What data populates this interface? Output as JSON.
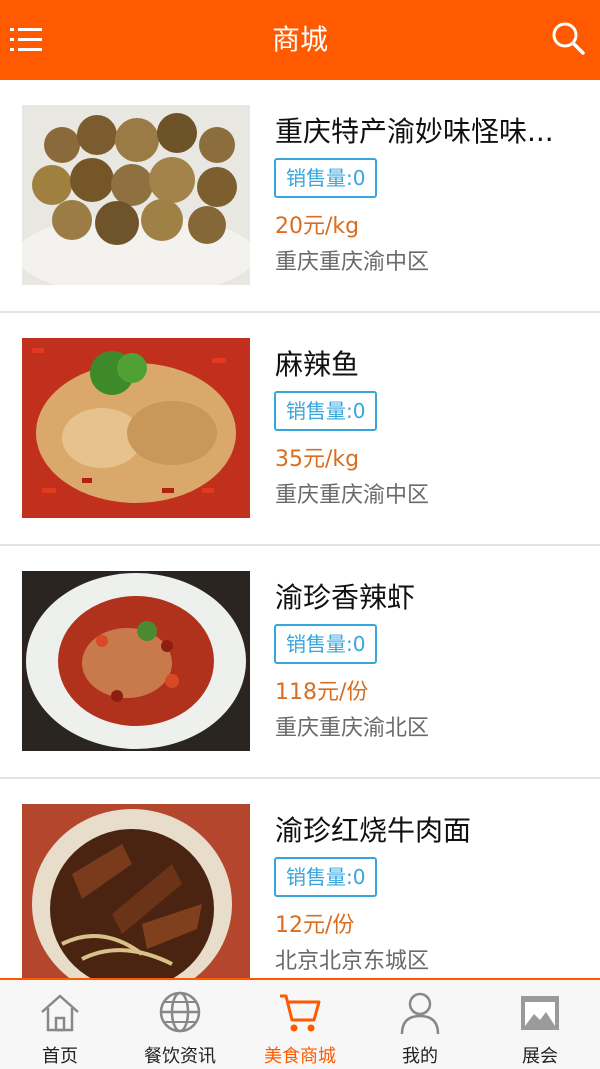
{
  "header": {
    "title": "商城",
    "menu_icon": "menu-icon",
    "search_icon": "search-icon",
    "color": "#ff5a00"
  },
  "products": [
    {
      "name": "重庆特产渝妙味怪味...",
      "sales": "销售量:0",
      "price": "20元/kg",
      "location": "重庆重庆渝中区"
    },
    {
      "name": "麻辣鱼",
      "sales": "销售量:0",
      "price": "35元/kg",
      "location": "重庆重庆渝中区"
    },
    {
      "name": "渝珍香辣虾",
      "sales": "销售量:0",
      "price": "118元/份",
      "location": "重庆重庆渝北区"
    },
    {
      "name": "渝珍红烧牛肉面",
      "sales": "销售量:0",
      "price": "12元/份",
      "location": "北京北京东城区"
    }
  ],
  "tabs": [
    {
      "label": "首页",
      "icon": "home-icon",
      "active": false
    },
    {
      "label": "餐饮资讯",
      "icon": "globe-icon",
      "active": false
    },
    {
      "label": "美食商城",
      "icon": "cart-icon",
      "active": true
    },
    {
      "label": "我的",
      "icon": "person-icon",
      "active": false
    },
    {
      "label": "展会",
      "icon": "gallery-icon",
      "active": false
    }
  ],
  "colors": {
    "accent": "#ff5a00",
    "badge": "#37a6dd",
    "price": "#d96d20"
  }
}
